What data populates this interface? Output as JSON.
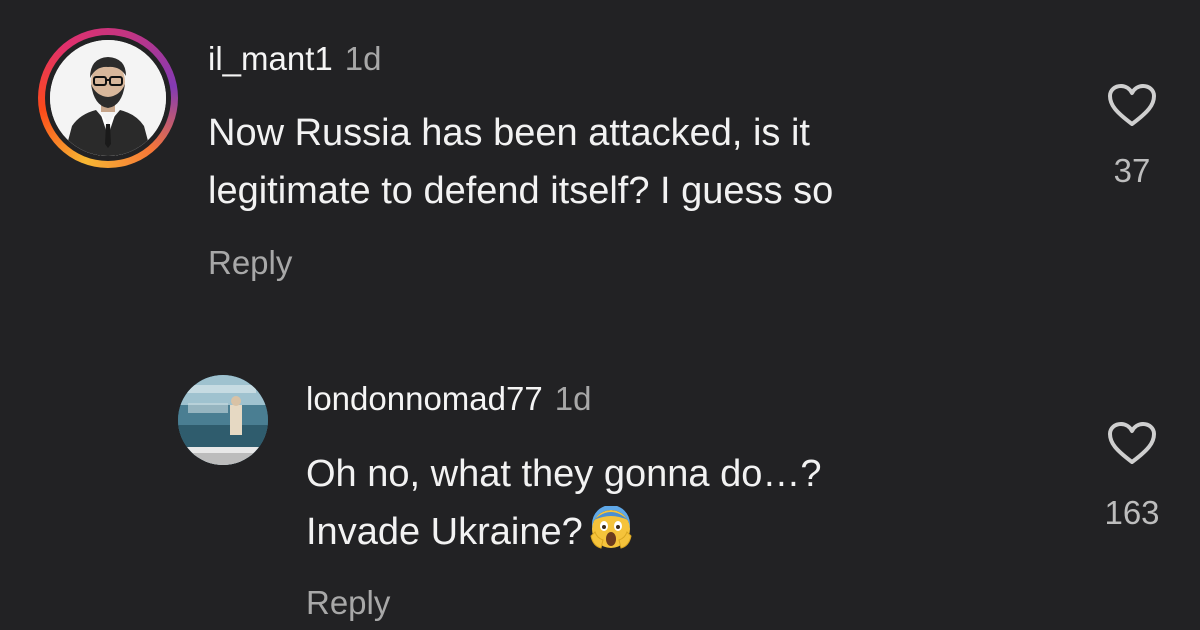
{
  "comments": [
    {
      "username": "il_mant1",
      "time": "1d",
      "lines": [
        "Now Russia has been attacked, is it",
        "legitimate to defend itself? I guess so"
      ],
      "reply_label": "Reply",
      "likes": "37"
    },
    {
      "username": "londonnomad77",
      "time": "1d",
      "lines": [
        "Oh no, what they gonna do…?",
        "Invade Ukraine?"
      ],
      "emoji": "face-screaming-in-fear",
      "reply_label": "Reply",
      "likes": "163"
    }
  ],
  "colors": {
    "background": "#222224",
    "text": "#f2f2f2",
    "muted": "#a8a8a8"
  }
}
